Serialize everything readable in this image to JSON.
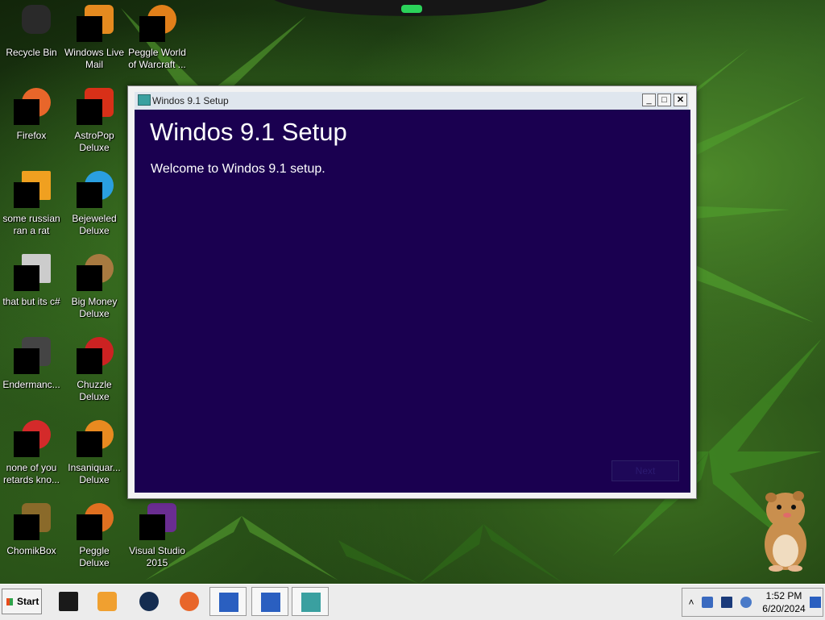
{
  "desktop": {
    "icons": [
      {
        "label": "Recycle Bin",
        "icon": "recycle-bin-icon",
        "color": "#2a2a2a"
      },
      {
        "label": "Windows Live\nMail",
        "icon": "mail-icon",
        "color": "#e58a1f"
      },
      {
        "label": "Peggle World\nof Warcraft ...",
        "icon": "peggle-icon",
        "color": "#e2801a"
      },
      {
        "label": "Firefox",
        "icon": "firefox-icon",
        "color": "#e8662a"
      },
      {
        "label": "AstroPop\nDeluxe",
        "icon": "astropop-icon",
        "color": "#d83018"
      },
      {
        "label": "some russian\nran a rat",
        "icon": "file-icon",
        "color": "#f0a020"
      },
      {
        "label": "Bejeweled\nDeluxe",
        "icon": "bejeweled-icon",
        "color": "#2a9fe0"
      },
      {
        "label": "that but its c#",
        "icon": "window-stack-icon",
        "color": "#cccccc"
      },
      {
        "label": "Big Money\nDeluxe",
        "icon": "money-bag-icon",
        "color": "#a87a40"
      },
      {
        "label": "Endermanc...",
        "icon": "app-icon",
        "color": "#444444"
      },
      {
        "label": "Chuzzle\nDeluxe",
        "icon": "chuzzle-icon",
        "color": "#cc2222"
      },
      {
        "label": "none of you\nretards kno...",
        "icon": "media-icon",
        "color": "#d42a2a"
      },
      {
        "label": "Insaniquar...\nDeluxe",
        "icon": "fish-icon",
        "color": "#e88a20"
      },
      {
        "label": "ChomikBox",
        "icon": "chomikbox-icon",
        "color": "#8a6a2a"
      },
      {
        "label": "Peggle Deluxe",
        "icon": "peggle-deluxe-icon",
        "color": "#e07020"
      },
      {
        "label": "Visual Studio\n2015",
        "icon": "visual-studio-icon",
        "color": "#6a2d91"
      }
    ]
  },
  "setup": {
    "window_title": "Windos 9.1 Setup",
    "heading": "Windos 9.1 Setup",
    "welcome": "Welcome to Windos 9.1 setup.",
    "next_label": "Next",
    "minimize_glyph": "_",
    "maximize_glyph": "□",
    "close_glyph": "✕",
    "bg_color": "#1a0050"
  },
  "taskbar": {
    "start_label": "Start",
    "items": [
      {
        "icon": "terminal-icon",
        "boxed": false
      },
      {
        "icon": "media-player-icon",
        "boxed": false
      },
      {
        "icon": "globe-icon",
        "boxed": false
      },
      {
        "icon": "firefox-icon",
        "boxed": false
      },
      {
        "icon": "checklist-warning-icon",
        "boxed": true
      },
      {
        "icon": "checklist-warning-icon",
        "boxed": true
      },
      {
        "icon": "setup-icon",
        "boxed": true
      }
    ],
    "tray": {
      "show_hidden_glyph": "˄",
      "clock_time": "1:52 PM",
      "clock_date": "6/20/2024"
    }
  }
}
